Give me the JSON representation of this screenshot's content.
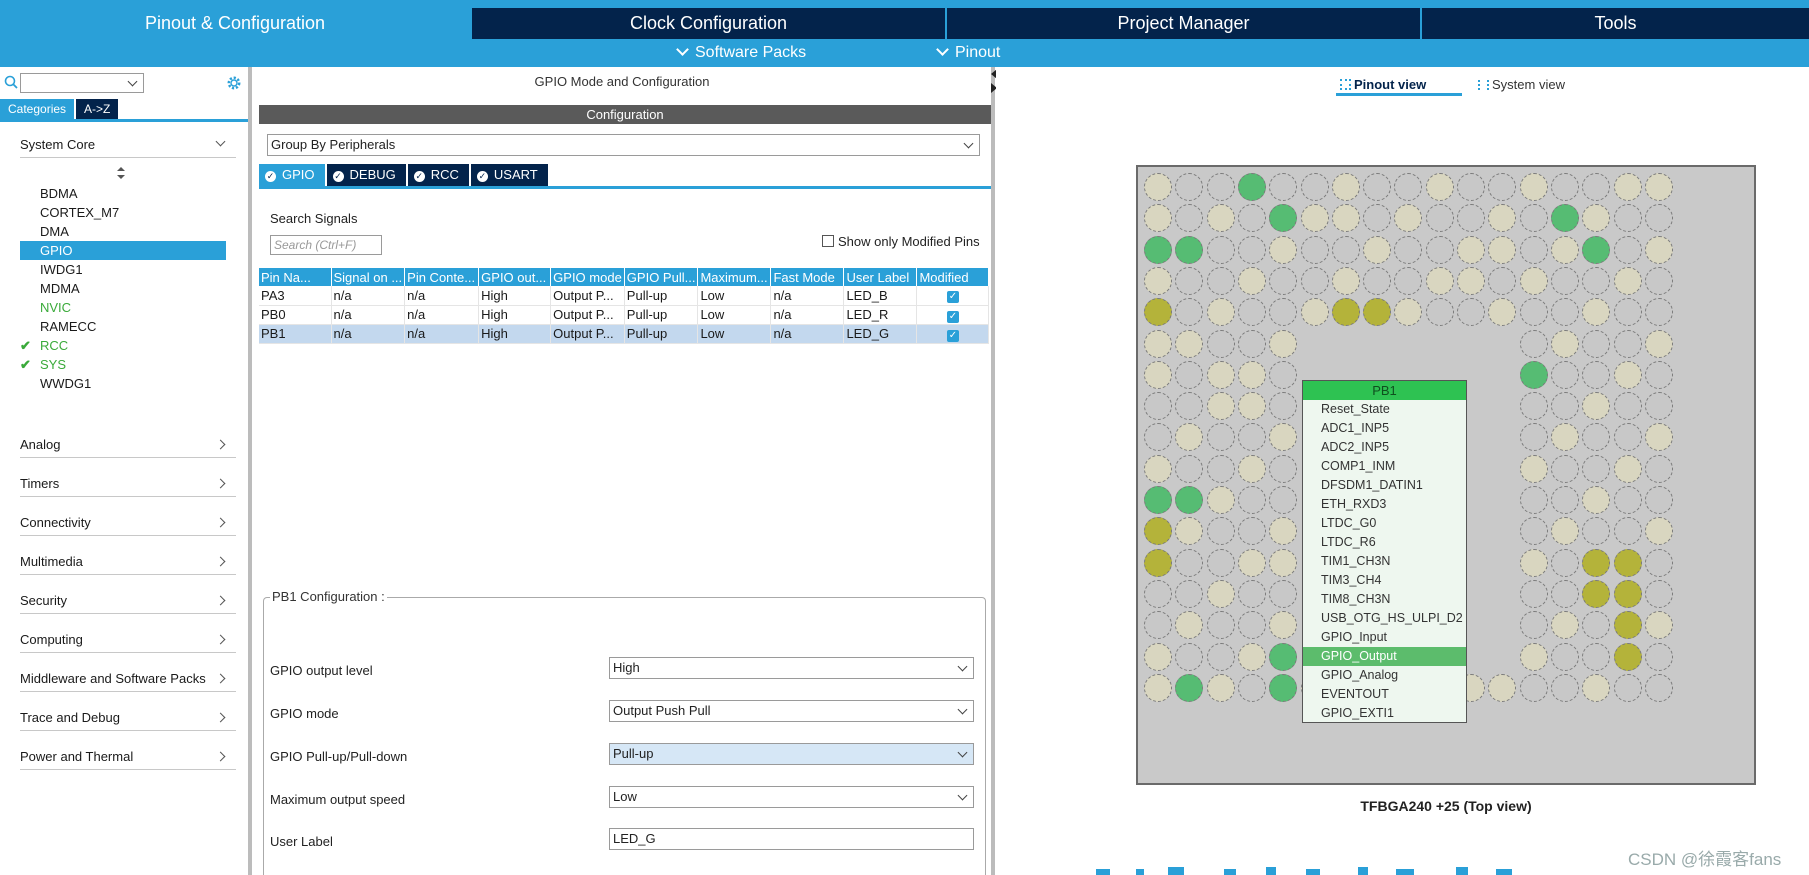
{
  "main_tabs": [
    {
      "label": "Pinout & Configuration",
      "active": true
    },
    {
      "label": "Clock Configuration",
      "active": false
    },
    {
      "label": "Project Manager",
      "active": false
    },
    {
      "label": "Tools",
      "active": false
    }
  ],
  "subnav": {
    "software_packs": "Software Packs",
    "pinout": "Pinout"
  },
  "left": {
    "category_tabs": [
      "Categories",
      "A->Z"
    ],
    "system_core": {
      "label": "System Core",
      "items": [
        "BDMA",
        "CORTEX_M7",
        "DMA",
        "GPIO",
        "IWDG1",
        "MDMA",
        "NVIC",
        "RAMECC",
        "RCC",
        "SYS",
        "WWDG1"
      ]
    },
    "groups": [
      "Analog",
      "Timers",
      "Connectivity",
      "Multimedia",
      "Security",
      "Computing",
      "Middleware and Software Packs",
      "Trace and Debug",
      "Power and Thermal"
    ]
  },
  "middle": {
    "title": "GPIO Mode and Configuration",
    "configuration_label": "Configuration",
    "group_by": "Group By Peripherals",
    "peripheral_tabs": [
      "GPIO",
      "DEBUG",
      "RCC",
      "USART"
    ],
    "search_label": "Search Signals",
    "search_placeholder": "Search (Ctrl+F)",
    "show_modified": "Show only Modified Pins",
    "table": {
      "headers": [
        "Pin Na...",
        "Signal on ...",
        "Pin Conte...",
        "GPIO out...",
        "GPIO mode",
        "GPIO Pull...",
        "Maximum...",
        "Fast Mode",
        "User Label",
        "Modified"
      ],
      "rows": [
        {
          "c0": "PA3",
          "c1": "n/a",
          "c2": "n/a",
          "c3": "High",
          "c4": "Output P...",
          "c5": "Pull-up",
          "c6": "Low",
          "c7": "n/a",
          "c8": "LED_B",
          "modified": true
        },
        {
          "c0": "PB0",
          "c1": "n/a",
          "c2": "n/a",
          "c3": "High",
          "c4": "Output P...",
          "c5": "Pull-up",
          "c6": "Low",
          "c7": "n/a",
          "c8": "LED_R",
          "modified": true
        },
        {
          "c0": "PB1",
          "c1": "n/a",
          "c2": "n/a",
          "c3": "High",
          "c4": "Output P...",
          "c5": "Pull-up",
          "c6": "Low",
          "c7": "n/a",
          "c8": "LED_G",
          "modified": true
        }
      ]
    },
    "pin_config": {
      "legend": "PB1 Configuration :",
      "output_level_label": "GPIO output level",
      "output_level": "High",
      "mode_label": "GPIO mode",
      "mode": "Output Push Pull",
      "pull_label": "GPIO Pull-up/Pull-down",
      "pull": "Pull-up",
      "speed_label": "Maximum output speed",
      "speed": "Low",
      "user_label_label": "User Label",
      "user_label": "LED_G"
    }
  },
  "right": {
    "pinout_view": "Pinout view",
    "system_view": "System view",
    "package_caption": "TFBGA240 +25 (Top view)",
    "popup": {
      "title": "PB1",
      "items": [
        "Reset_State",
        "ADC1_INP5",
        "ADC2_INP5",
        "COMP1_INM",
        "DFSDM1_DATIN1",
        "ETH_RXD3",
        "LTDC_G0",
        "LTDC_R6",
        "TIM1_CH3N",
        "TIM3_CH4",
        "TIM8_CH3N",
        "USB_OTG_HS_ULPI_D2",
        "GPIO_Input",
        "GPIO_Output",
        "GPIO_Analog",
        "EVENTOUT",
        "GPIO_EXTI1"
      ],
      "selected": "GPIO_Output"
    },
    "watermark": "CSDN @徐霞客fans"
  },
  "colors": {
    "accent": "#2aa0d8",
    "dark_tab": "#03234b",
    "pin_green": "#56bc73",
    "pin_olive": "#b4b33a"
  }
}
